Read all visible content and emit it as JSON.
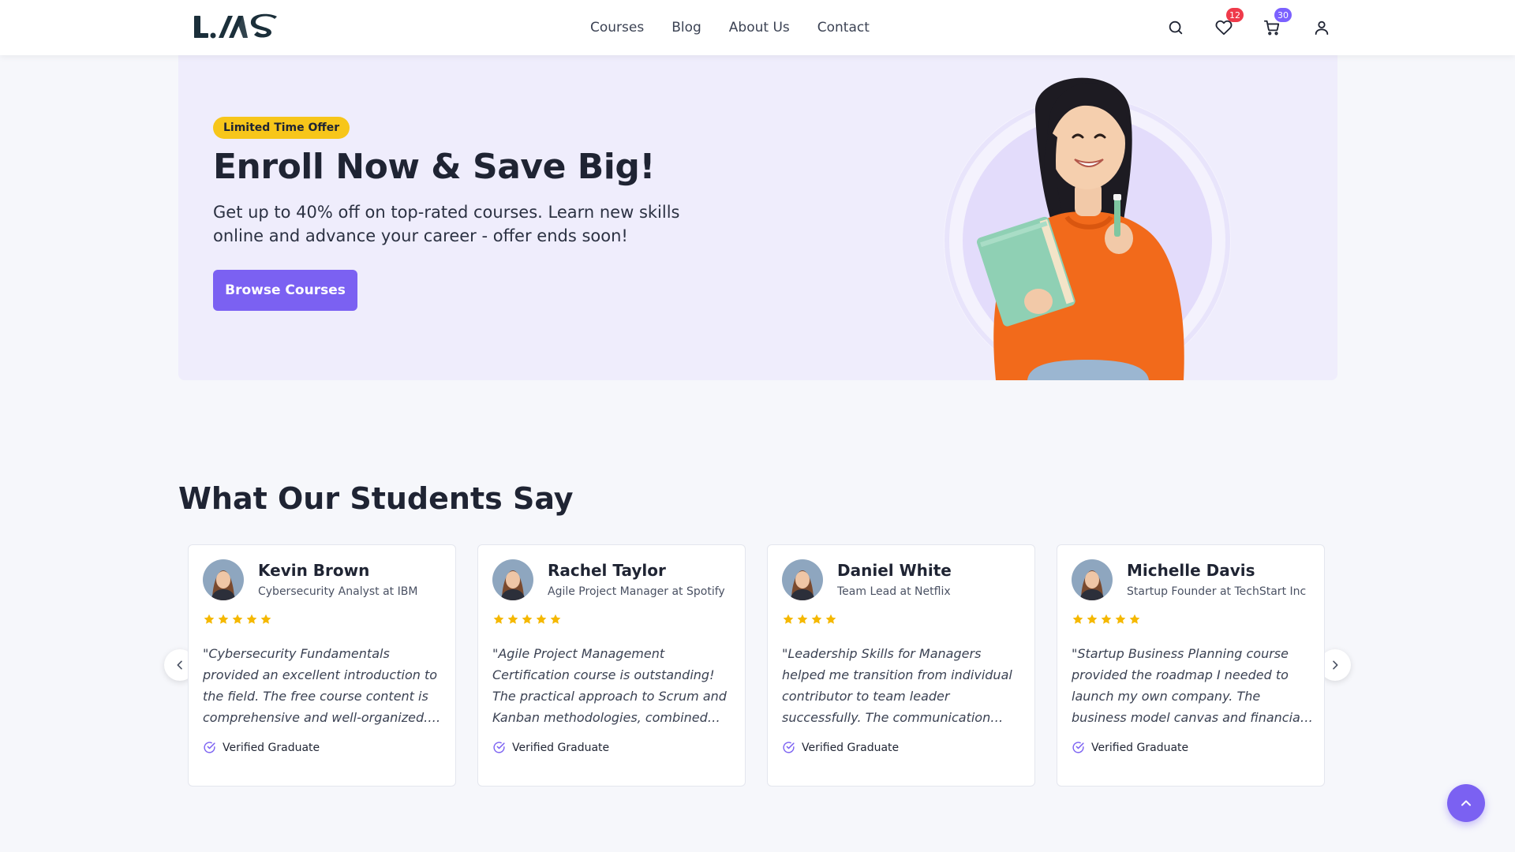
{
  "header": {
    "logo_text": "LMS",
    "nav": [
      "Courses",
      "Blog",
      "About Us",
      "Contact"
    ],
    "icons": [
      "search-icon",
      "heart-icon",
      "cart-icon",
      "user-icon"
    ],
    "wishlist_count": "12",
    "cart_count": "30"
  },
  "hero": {
    "badge": "Limited Time Offer",
    "title": "Enroll Now & Save Big!",
    "text": "Get up to 40% off on top-rated courses. Learn new skills online and advance your career - offer ends soon!",
    "button": "Browse Courses"
  },
  "testimonials": {
    "title": "What Our Students Say",
    "items": [
      {
        "name": "Kevin Brown",
        "role": "Cybersecurity Analyst at IBM",
        "rating": 5,
        "quote": "\"Cybersecurity Fundamentals provided an excellent introduction to the field. The free course content is comprehensive and well-organized. It...",
        "verified": "Verified Graduate"
      },
      {
        "name": "Rachel Taylor",
        "role": "Agile Project Manager at Spotify",
        "rating": 5,
        "quote": "\"Agile Project Management Certification course is outstanding! The practical approach to Scrum and Kanban methodologies, combined wi...",
        "verified": "Verified Graduate"
      },
      {
        "name": "Daniel White",
        "role": "Team Lead at Netflix",
        "rating": 4,
        "quote": "\"Leadership Skills for Managers helped me transition from individual contributor to team leader successfully. The communication strategies and...",
        "verified": "Verified Graduate"
      },
      {
        "name": "Michelle Davis",
        "role": "Startup Founder at TechStart Inc",
        "rating": 5,
        "quote": "\"Startup Business Planning course provided the roadmap I needed to launch my own company. The business model canvas and financial planning...",
        "verified": "Verified Graduate"
      }
    ]
  },
  "colors": {
    "accent": "#7b61f2",
    "badge_yellow": "#f7c61a",
    "hero_bg": "#efedfc",
    "star": "#f5b800",
    "orange": "#f26a1b"
  }
}
